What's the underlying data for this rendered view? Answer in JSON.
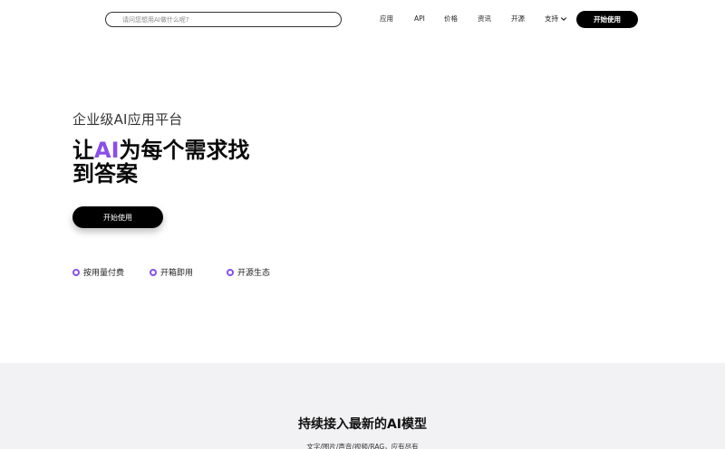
{
  "nav": {
    "search_placeholder": "请问您想用AI做什么呢?",
    "items": [
      "应用",
      "API",
      "价格",
      "资讯",
      "开源"
    ],
    "support_label": "支持",
    "start_label": "开始使用"
  },
  "hero": {
    "subtitle": "企业级AI应用平台",
    "title_prefix": "让",
    "title_highlight": "AI",
    "title_suffix": "为每个需求找到答案",
    "cta_label": "开始使用",
    "features": [
      "按用量付费",
      "开箱即用",
      "开源生态"
    ],
    "accent_color": "#8a4fe8"
  },
  "models_section": {
    "title": "持续接入最新的AI模型",
    "subtitle": "文字/图片/声音/视频/RAG，应有尽有"
  },
  "icons": {
    "support_dropdown": "chevron-down-icon",
    "feature_bullet": "ring-bullet-icon"
  }
}
